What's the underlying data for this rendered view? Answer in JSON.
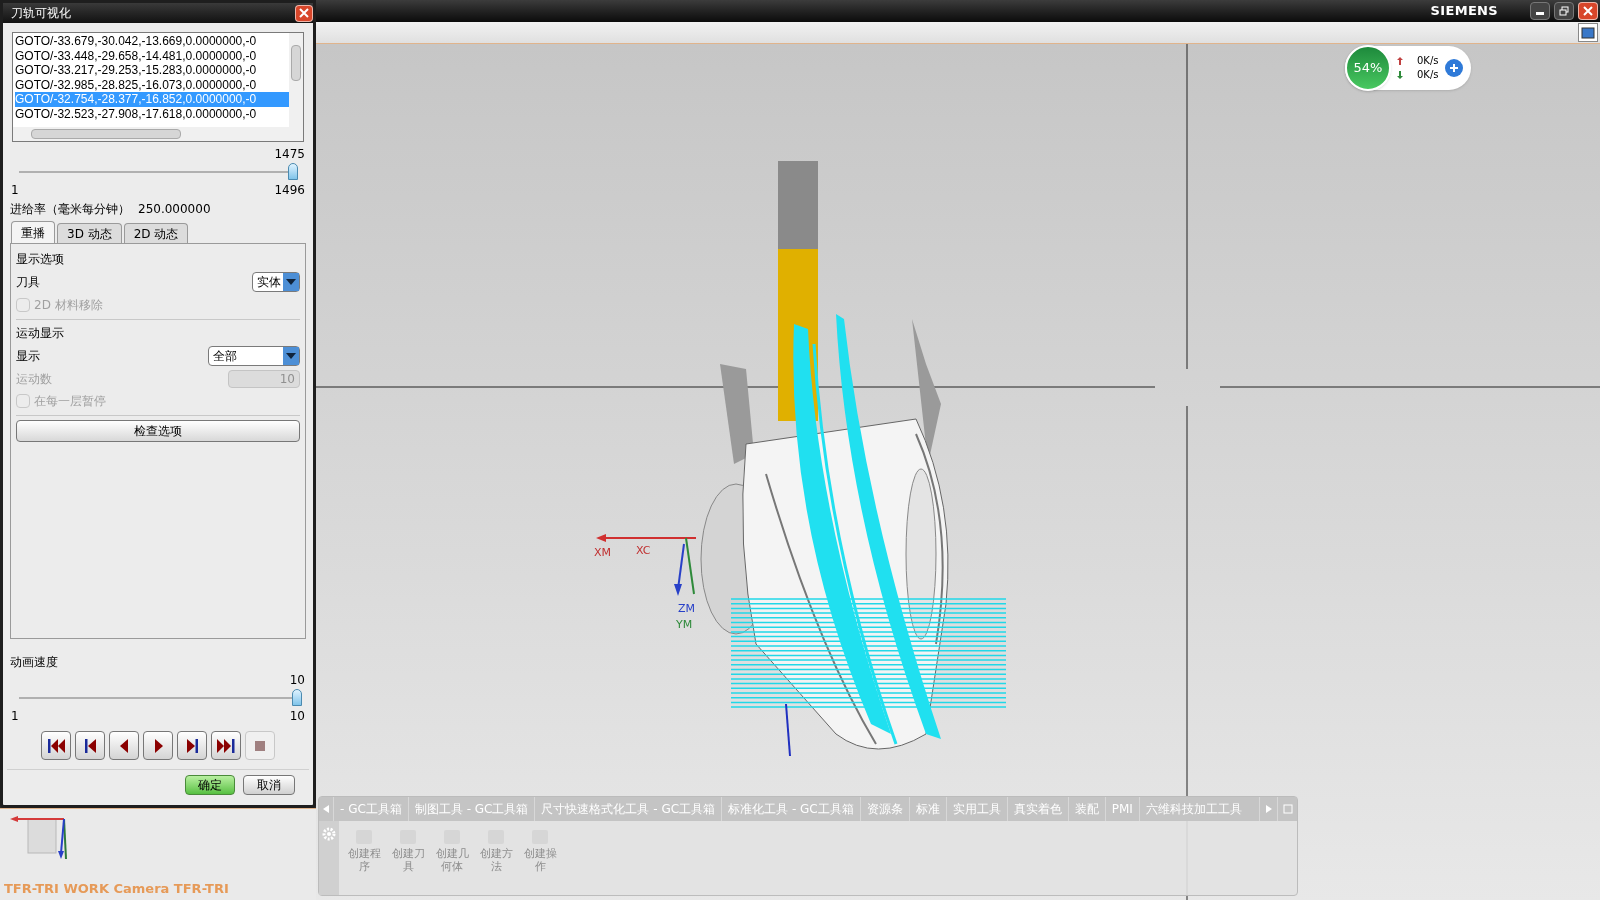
{
  "app": {
    "brand": "SIEMENS"
  },
  "dialog": {
    "title": "刀轨可视化",
    "path_rows": [
      {
        "text": "GOTO/-33.679,-30.042,-13.669,0.0000000,-0",
        "selected": false
      },
      {
        "text": "GOTO/-33.448,-29.658,-14.481,0.0000000,-0",
        "selected": false
      },
      {
        "text": "GOTO/-33.217,-29.253,-15.283,0.0000000,-0",
        "selected": false
      },
      {
        "text": "GOTO/-32.985,-28.825,-16.073,0.0000000,-0",
        "selected": false
      },
      {
        "text": "GOTO/-32.754,-28.377,-16.852,0.0000000,-0",
        "selected": true
      },
      {
        "text": "GOTO/-32.523,-27.908,-17.618,0.0000000,-0",
        "selected": false
      }
    ],
    "path_slider": {
      "value": "1475",
      "min": "1",
      "max": "1496",
      "level": 0.986
    },
    "feed_rate": {
      "label": "进给率（毫米每分钟）",
      "value": "250.000000"
    },
    "tabs": [
      {
        "label": "重播",
        "selected": true
      },
      {
        "label": "3D 动态",
        "selected": false
      },
      {
        "label": "2D 动态",
        "selected": false
      }
    ],
    "display_options": {
      "title": "显示选项",
      "tool_label": "刀具",
      "tool_value": "实体",
      "material_removal": {
        "label": "2D 材料移除",
        "checked": false,
        "disabled": true
      }
    },
    "motion_display": {
      "title": "运动显示",
      "display_label": "显示",
      "display_value": "全部",
      "count_label": "运动数",
      "count_value": "10",
      "count_disabled": true,
      "pause": {
        "label": "在每一层暂停",
        "checked": false,
        "disabled": true
      }
    },
    "check_button": "检查选项",
    "speed": {
      "label": "动画速度",
      "value": "10",
      "min": "1",
      "max": "10",
      "level": 1
    },
    "playback": [
      {
        "kind": "first",
        "disabled": false
      },
      {
        "kind": "step-back",
        "disabled": false
      },
      {
        "kind": "reverse",
        "disabled": false
      },
      {
        "kind": "play",
        "disabled": false
      },
      {
        "kind": "step-forward",
        "disabled": false
      },
      {
        "kind": "last",
        "disabled": false
      },
      {
        "kind": "stop",
        "disabled": true
      }
    ],
    "ok": "确定",
    "cancel": "取消"
  },
  "camera": {
    "label": "TFR-TRI WORK Camera TFR-TRI"
  },
  "network": {
    "percent": "54%",
    "upload": "0K/s",
    "download": "0K/s"
  },
  "viewport": {
    "axes": {
      "xm": "XM",
      "xc": "XC",
      "zm": "ZM",
      "ym": "YM"
    }
  },
  "toolbar": {
    "tabs": [
      "- GC工具箱",
      "制图工具 - GC工具箱",
      "尺寸快速格式化工具 - GC工具箱",
      "标准化工具 - GC工具箱",
      "资源条",
      "标准",
      "实用工具",
      "真实着色",
      "装配",
      "PMI",
      "六维科技加工工具"
    ],
    "buttons": [
      {
        "label": "创建程序",
        "disabled": true
      },
      {
        "label": "创建刀具",
        "disabled": true
      },
      {
        "label": "创建几何体",
        "disabled": true
      },
      {
        "label": "创建方法",
        "disabled": true
      },
      {
        "label": "创建操作",
        "disabled": true
      }
    ]
  }
}
